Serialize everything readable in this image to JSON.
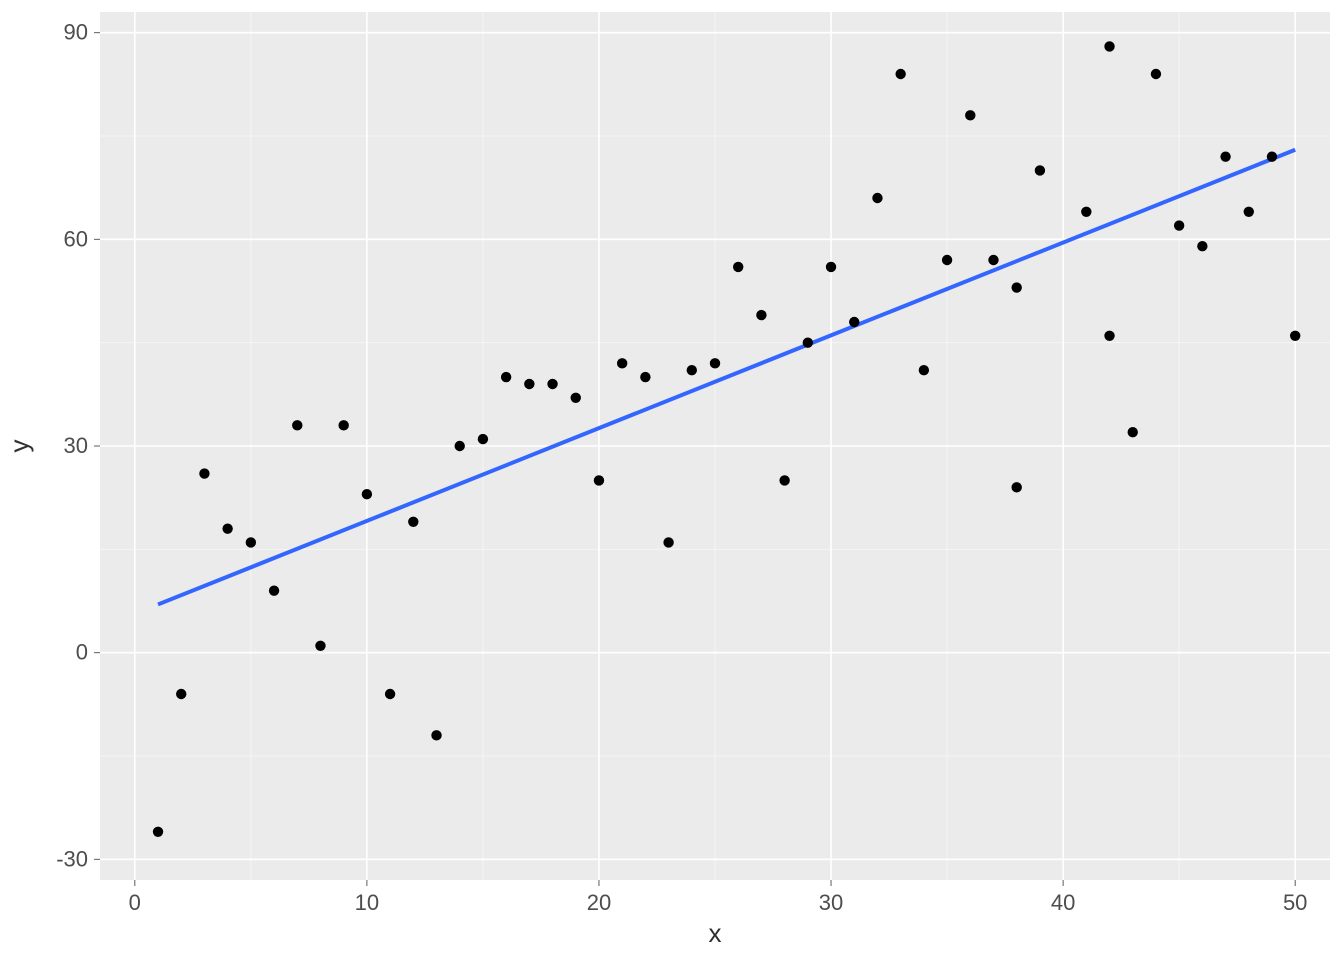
{
  "chart_data": {
    "type": "scatter",
    "xlabel": "x",
    "ylabel": "y",
    "xlim": [
      -1.5,
      51.5
    ],
    "ylim": [
      -33,
      93
    ],
    "x_ticks": [
      0,
      10,
      20,
      30,
      40,
      50
    ],
    "y_ticks": [
      -30,
      0,
      30,
      60,
      90
    ],
    "x_minor": [
      5,
      15,
      25,
      35,
      45
    ],
    "y_minor": [
      -15,
      15,
      45,
      75
    ],
    "points": [
      {
        "x": 1,
        "y": -26
      },
      {
        "x": 2,
        "y": -6
      },
      {
        "x": 3,
        "y": 26
      },
      {
        "x": 4,
        "y": 18
      },
      {
        "x": 5,
        "y": 16
      },
      {
        "x": 6,
        "y": 9
      },
      {
        "x": 7,
        "y": 33
      },
      {
        "x": 8,
        "y": 1
      },
      {
        "x": 9,
        "y": 33
      },
      {
        "x": 10,
        "y": 23
      },
      {
        "x": 11,
        "y": -6
      },
      {
        "x": 12,
        "y": 19
      },
      {
        "x": 13,
        "y": -12
      },
      {
        "x": 14,
        "y": 30
      },
      {
        "x": 15,
        "y": 31
      },
      {
        "x": 16,
        "y": 40
      },
      {
        "x": 17,
        "y": 39
      },
      {
        "x": 18,
        "y": 39
      },
      {
        "x": 19,
        "y": 37
      },
      {
        "x": 20,
        "y": 25
      },
      {
        "x": 21,
        "y": 42
      },
      {
        "x": 22,
        "y": 40
      },
      {
        "x": 23,
        "y": 16
      },
      {
        "x": 24,
        "y": 41
      },
      {
        "x": 25,
        "y": 42
      },
      {
        "x": 26,
        "y": 56
      },
      {
        "x": 27,
        "y": 49
      },
      {
        "x": 28,
        "y": 25
      },
      {
        "x": 29,
        "y": 45
      },
      {
        "x": 30,
        "y": 56
      },
      {
        "x": 31,
        "y": 48
      },
      {
        "x": 32,
        "y": 66
      },
      {
        "x": 33,
        "y": 84
      },
      {
        "x": 34,
        "y": 41
      },
      {
        "x": 35,
        "y": 57
      },
      {
        "x": 36,
        "y": 78
      },
      {
        "x": 37,
        "y": 57
      },
      {
        "x": 38,
        "y": 53
      },
      {
        "x": 38,
        "y": 24
      },
      {
        "x": 39,
        "y": 70
      },
      {
        "x": 41,
        "y": 64
      },
      {
        "x": 42,
        "y": 46
      },
      {
        "x": 42,
        "y": 88
      },
      {
        "x": 43,
        "y": 32
      },
      {
        "x": 44,
        "y": 84
      },
      {
        "x": 45,
        "y": 62
      },
      {
        "x": 46,
        "y": 59
      },
      {
        "x": 47,
        "y": 72
      },
      {
        "x": 48,
        "y": 64
      },
      {
        "x": 49,
        "y": 72
      },
      {
        "x": 50,
        "y": 46
      }
    ],
    "fit_line": {
      "x1": 1,
      "y1": 7,
      "x2": 50,
      "y2": 73
    },
    "line_color": "#3366ff",
    "point_color": "#000000",
    "grid": true
  }
}
